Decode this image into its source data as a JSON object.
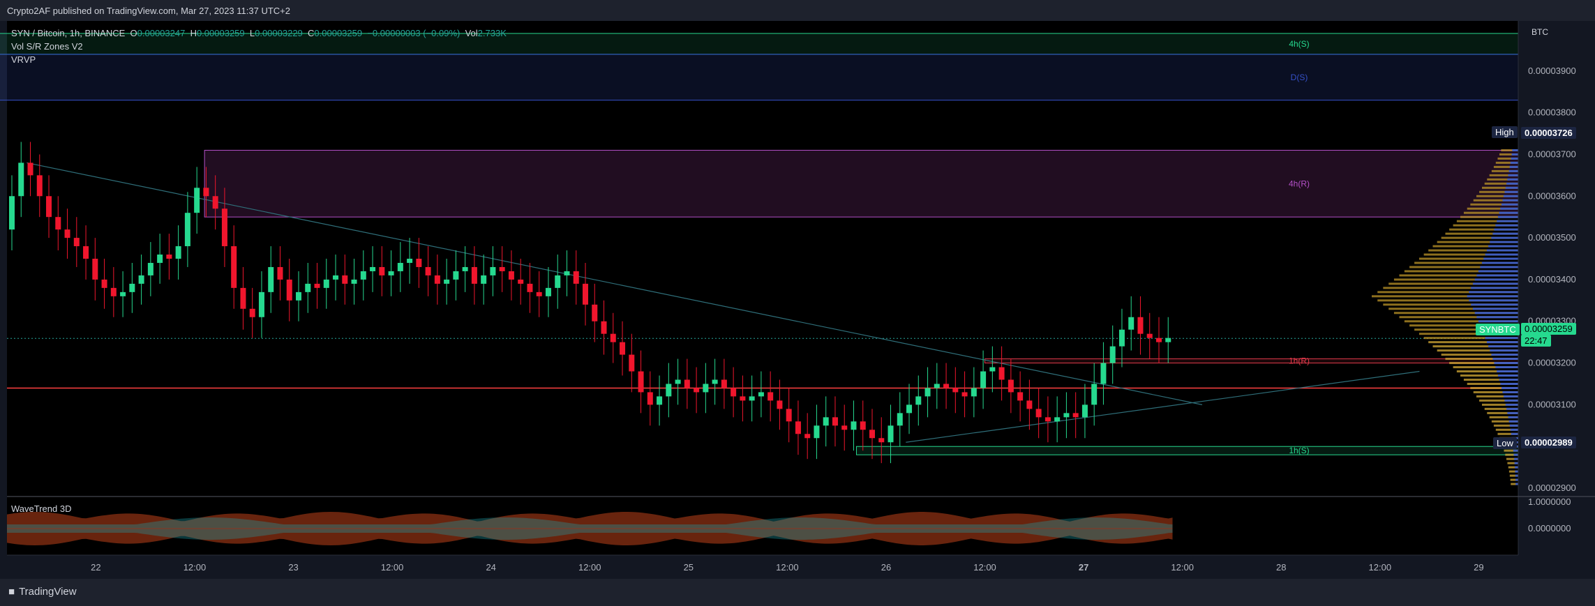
{
  "header": {
    "published": "Crypto2AF published on TradingView.com, Mar 27, 2023 11:37 UTC+2"
  },
  "legend": {
    "symbol": "SYN / Bitcoin, 1h, BINANCE",
    "o_label": "O",
    "o": "0.00003247",
    "h_label": "H",
    "h": "0.00003259",
    "l_label": "L",
    "l": "0.00003229",
    "c_label": "C",
    "c": "0.00003259",
    "change": "−0.00000003 (−0.09%)",
    "vol_label": "Vol",
    "vol": "2.733K",
    "ind1": "Vol S/R Zones V2",
    "ind2": "VRVP"
  },
  "oscillator": {
    "name": "WaveTrend 3D",
    "ticks": [
      "1.0000000",
      "0.0000000"
    ]
  },
  "axis": {
    "currency": "BTC"
  },
  "badges": {
    "high_label": "High",
    "high_value": "0.00003726",
    "low_label": "Low",
    "low_value": "0.00002989",
    "symbol": "SYNBTC",
    "last": "0.00003259",
    "countdown": "22:47"
  },
  "footer": {
    "brand": "TradingView"
  },
  "colors": {
    "up": "#26d98f",
    "down": "#f0162d",
    "support": "#26d98f",
    "resistance": "#e0394a"
  },
  "chart_data": {
    "type": "candlestick",
    "y_ticks": [
      "0.00003900",
      "0.00003800",
      "0.00003700",
      "0.00003600",
      "0.00003500",
      "0.00003400",
      "0.00003300",
      "0.00003200",
      "0.00003100",
      "0.00002900"
    ],
    "x_ticks": [
      {
        "label": "22",
        "day": 22
      },
      {
        "label": "12:00",
        "day": 22.5
      },
      {
        "label": "23",
        "day": 23
      },
      {
        "label": "12:00",
        "day": 23.5
      },
      {
        "label": "24",
        "day": 24
      },
      {
        "label": "12:00",
        "day": 24.5
      },
      {
        "label": "25",
        "day": 25
      },
      {
        "label": "12:00",
        "day": 25.5
      },
      {
        "label": "26",
        "day": 26
      },
      {
        "label": "12:00",
        "day": 26.5
      },
      {
        "label": "27",
        "day": 27
      },
      {
        "label": "12:00",
        "day": 27.5
      },
      {
        "label": "28",
        "day": 28
      },
      {
        "label": "12:00",
        "day": 28.5
      },
      {
        "label": "29",
        "day": 29
      }
    ],
    "zones": [
      {
        "label": "4h(S)",
        "low": 3.94e-05,
        "high": 3.99e-05,
        "x_from_day": 21.5,
        "x_to_day": 29.2,
        "kind": "support"
      },
      {
        "label": "D(S)",
        "low": 3.83e-05,
        "high": 3.94e-05,
        "x_from_day": 21.5,
        "x_to_day": 29.2,
        "kind": "blue"
      },
      {
        "label": "4h(R)",
        "low": 3.55e-05,
        "high": 3.71e-05,
        "x_from_day": 22.55,
        "x_to_day": 29.2,
        "kind": "purple"
      },
      {
        "label": "1h(R)",
        "low": 3.2e-05,
        "high": 3.21e-05,
        "x_from_day": 26.5,
        "x_to_day": 29.2,
        "kind": "resistance"
      },
      {
        "label": "1h(S)",
        "low": 2.98e-05,
        "high": 3e-05,
        "x_from_day": 25.85,
        "x_to_day": 29.2,
        "kind": "support"
      }
    ],
    "candles_note": "hourly OHLC, Mar 21 12:00 – Mar 27 11:00",
    "closes": [
      3.6e-05,
      3.68e-05,
      3.65e-05,
      3.6e-05,
      3.55e-05,
      3.52e-05,
      3.5e-05,
      3.48e-05,
      3.45e-05,
      3.4e-05,
      3.38e-05,
      3.36e-05,
      3.37e-05,
      3.39e-05,
      3.41e-05,
      3.44e-05,
      3.46e-05,
      3.45e-05,
      3.48e-05,
      3.56e-05,
      3.62e-05,
      3.6e-05,
      3.57e-05,
      3.48e-05,
      3.38e-05,
      3.33e-05,
      3.31e-05,
      3.37e-05,
      3.43e-05,
      3.4e-05,
      3.35e-05,
      3.37e-05,
      3.39e-05,
      3.38e-05,
      3.4e-05,
      3.41e-05,
      3.39e-05,
      3.4e-05,
      3.42e-05,
      3.43e-05,
      3.41e-05,
      3.42e-05,
      3.44e-05,
      3.45e-05,
      3.43e-05,
      3.41e-05,
      3.39e-05,
      3.4e-05,
      3.42e-05,
      3.43e-05,
      3.39e-05,
      3.41e-05,
      3.43e-05,
      3.42e-05,
      3.4e-05,
      3.39e-05,
      3.37e-05,
      3.36e-05,
      3.38e-05,
      3.41e-05,
      3.42e-05,
      3.39e-05,
      3.34e-05,
      3.3e-05,
      3.27e-05,
      3.25e-05,
      3.22e-05,
      3.18e-05,
      3.13e-05,
      3.1e-05,
      3.12e-05,
      3.15e-05,
      3.16e-05,
      3.14e-05,
      3.13e-05,
      3.15e-05,
      3.16e-05,
      3.14e-05,
      3.12e-05,
      3.11e-05,
      3.12e-05,
      3.13e-05,
      3.11e-05,
      3.09e-05,
      3.06e-05,
      3.03e-05,
      3.02e-05,
      3.05e-05,
      3.07e-05,
      3.05e-05,
      3.04e-05,
      3.06e-05,
      3.04e-05,
      3.02e-05,
      3.01e-05,
      3.05e-05,
      3.08e-05,
      3.1e-05,
      3.12e-05,
      3.14e-05,
      3.15e-05,
      3.14e-05,
      3.13e-05,
      3.12e-05,
      3.14e-05,
      3.18e-05,
      3.19e-05,
      3.16e-05,
      3.13e-05,
      3.11e-05,
      3.09e-05,
      3.07e-05,
      3.06e-05,
      3.07e-05,
      3.08e-05,
      3.07e-05,
      3.1e-05,
      3.15e-05,
      3.2e-05,
      3.24e-05,
      3.28e-05,
      3.31e-05,
      3.27e-05,
      3.26e-05,
      3.25e-05,
      3.26e-05
    ]
  }
}
